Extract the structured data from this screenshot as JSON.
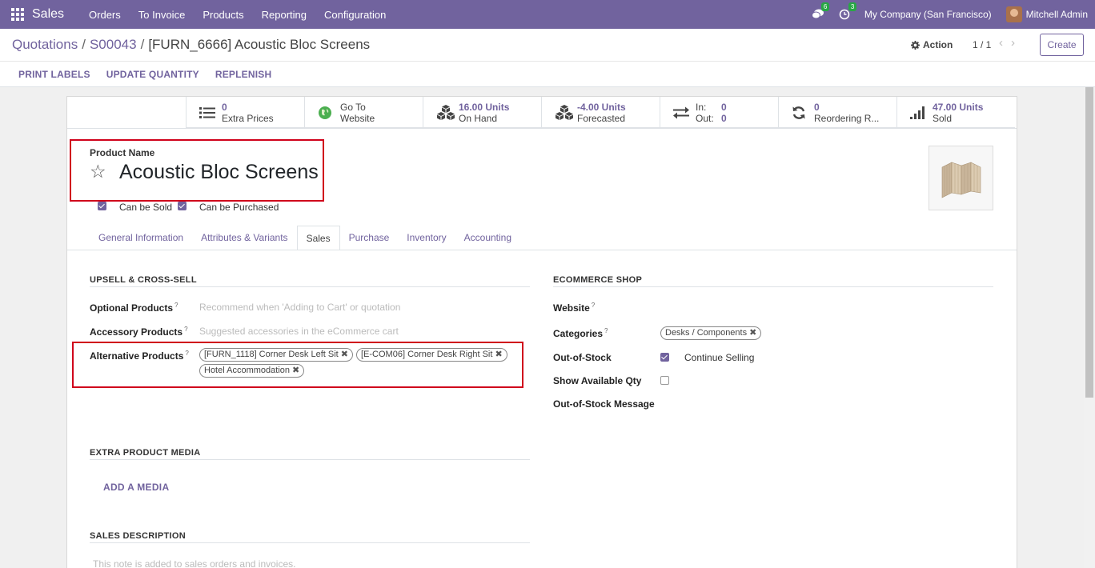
{
  "navbar": {
    "app_name": "Sales",
    "menu": [
      "Orders",
      "To Invoice",
      "Products",
      "Reporting",
      "Configuration"
    ],
    "messages_count": "6",
    "activities_count": "3",
    "company": "My Company (San Francisco)",
    "user": "Mitchell Admin"
  },
  "breadcrumb": {
    "items": [
      "Quotations",
      "S00043"
    ],
    "current": "[FURN_6666] Acoustic Bloc Screens"
  },
  "control": {
    "action_label": "Action",
    "pager": "1 / 1",
    "create_label": "Create"
  },
  "statusbar": [
    "PRINT LABELS",
    "UPDATE QUANTITY",
    "REPLENISH"
  ],
  "smart_buttons": [
    {
      "icon": "list-icon",
      "value": "0",
      "label": "Extra Prices"
    },
    {
      "icon": "globe-icon",
      "value": "Go To",
      "label": "Website"
    },
    {
      "icon": "cubes-icon",
      "value": "16.00 Units",
      "label": "On Hand"
    },
    {
      "icon": "cubes-icon",
      "value": "-4.00 Units",
      "label": "Forecasted"
    },
    {
      "icon": "exchange-icon",
      "in_label": "In:",
      "in_value": "0",
      "out_label": "Out:",
      "out_value": "0"
    },
    {
      "icon": "refresh-icon",
      "value": "0",
      "label": "Reordering R..."
    },
    {
      "icon": "signal-icon",
      "value": "47.00 Units",
      "label": "Sold"
    }
  ],
  "product": {
    "name_label": "Product Name",
    "name": "Acoustic Bloc Screens",
    "can_be_sold": "Can be Sold",
    "can_be_purchased": "Can be Purchased"
  },
  "tabs": [
    "General Information",
    "Attributes & Variants",
    "Sales",
    "Purchase",
    "Inventory",
    "Accounting"
  ],
  "active_tab": "Sales",
  "upsell": {
    "title": "UPSELL & CROSS-SELL",
    "optional_label": "Optional Products",
    "optional_placeholder": "Recommend when 'Adding to Cart' or quotation",
    "accessory_label": "Accessory Products",
    "accessory_placeholder": "Suggested accessories in the eCommerce cart",
    "alternative_label": "Alternative Products",
    "alternative_tags": [
      "[FURN_1118] Corner Desk Left Sit",
      "[E-COM06] Corner Desk Right Sit",
      "Hotel Accommodation"
    ]
  },
  "ecommerce": {
    "title": "ECOMMERCE SHOP",
    "website_label": "Website",
    "categories_label": "Categories",
    "category_tag": "Desks / Components",
    "oos_label": "Out-of-Stock",
    "oos_value": "Continue Selling",
    "show_qty_label": "Show Available Qty",
    "oos_message_label": "Out-of-Stock Message"
  },
  "media": {
    "title": "EXTRA PRODUCT MEDIA",
    "add_label": "ADD A MEDIA"
  },
  "sales_desc": {
    "title": "SALES DESCRIPTION",
    "placeholder": "This note is added to sales orders and invoices."
  },
  "help_mark": "?",
  "remove_mark": "✖"
}
